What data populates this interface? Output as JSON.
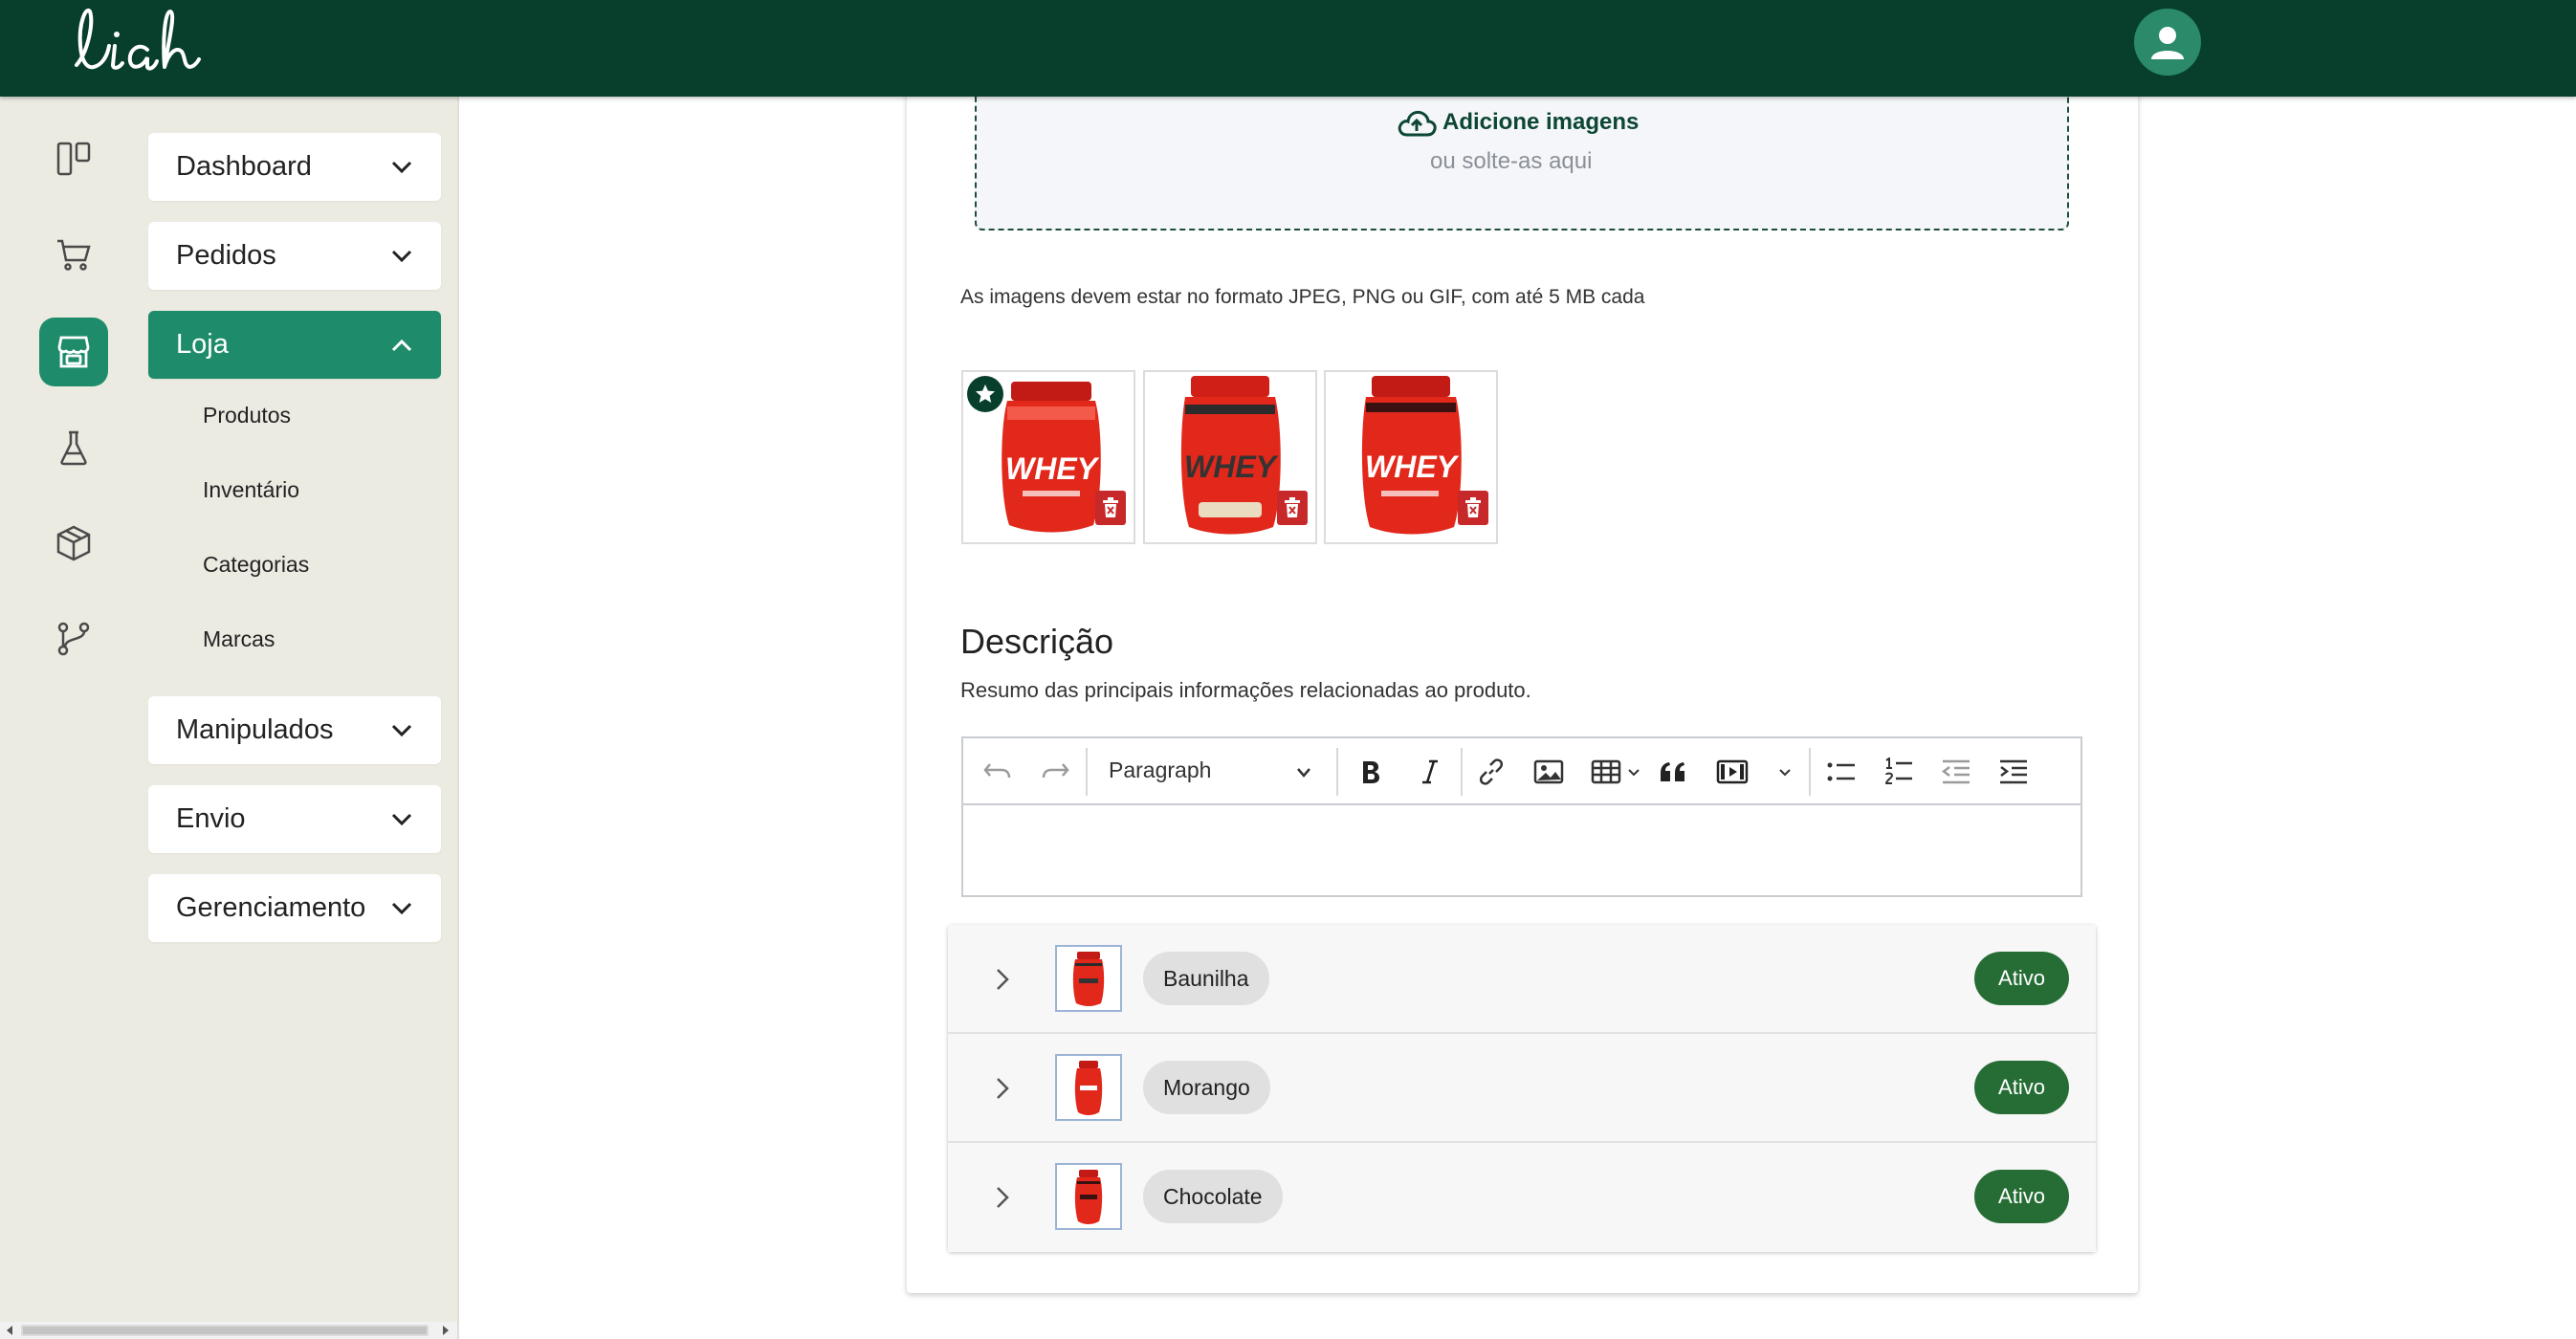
{
  "app": {
    "logo_text": "liah"
  },
  "header": {
    "avatar_icon": "user-icon"
  },
  "rail": {
    "icons": [
      "dashboard-icon",
      "cart-icon",
      "store-icon",
      "flask-icon",
      "box-icon",
      "branch-icon"
    ],
    "active": "store-icon"
  },
  "sidebar": {
    "items": [
      {
        "label": "Dashboard",
        "chevron": "down"
      },
      {
        "label": "Pedidos",
        "chevron": "down"
      },
      {
        "label": "Loja",
        "chevron": "up"
      },
      {
        "label": "Manipulados",
        "chevron": "down"
      },
      {
        "label": "Envio",
        "chevron": "down"
      },
      {
        "label": "Gerenciamento",
        "chevron": "down"
      }
    ],
    "loja_sub": [
      "Produtos",
      "Inventário",
      "Categorias",
      "Marcas"
    ]
  },
  "upload": {
    "title": "Adicione imagens",
    "subtitle": "ou solte-as aqui",
    "hint": "As imagens devem estar no formato JPEG, PNG ou GIF, com até 5 MB cada"
  },
  "images": [
    {
      "label": "WHEY",
      "featured": true
    },
    {
      "label": "WHEY",
      "featured": false
    },
    {
      "label": "WHEY",
      "featured": false
    }
  ],
  "description": {
    "title": "Descrição",
    "subtitle": "Resumo das principais informações relacionadas ao produto.",
    "toolbar": {
      "block_format": "Paragraph"
    },
    "content": ""
  },
  "variants": [
    {
      "name": "Baunilha",
      "status": "Ativo"
    },
    {
      "name": "Morango",
      "status": "Ativo"
    },
    {
      "name": "Chocolate",
      "status": "Ativo"
    }
  ],
  "colors": {
    "brand_dark": "#073f2c",
    "brand_green": "#1e8c6b",
    "status_green": "#266d35",
    "danger": "#c7282a"
  }
}
